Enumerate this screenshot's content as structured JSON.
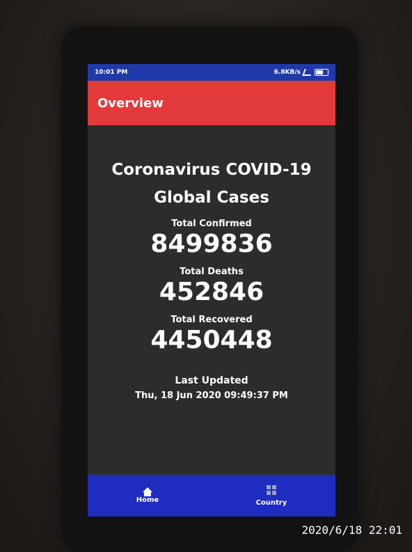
{
  "status_bar": {
    "time": "10:01 PM",
    "speed": "6.8KB/s"
  },
  "app_bar": {
    "title": "Overview"
  },
  "main": {
    "heading_line1": "Coronavirus COVID-19",
    "heading_line2": "Global Cases",
    "confirmed_label": "Total Confirmed",
    "confirmed_value": "8499836",
    "deaths_label": "Total Deaths",
    "deaths_value": "452846",
    "recovered_label": "Total Recovered",
    "recovered_value": "4450448",
    "last_updated_label": "Last Updated",
    "last_updated_value": "Thu, 18 Jun 2020 09:49:37 PM"
  },
  "bottom_nav": {
    "items": [
      {
        "label": "Home",
        "icon": "home-icon"
      },
      {
        "label": "Country",
        "icon": "grid-icon"
      }
    ]
  },
  "photo_timestamp": "2020/6/18  22:01",
  "colors": {
    "status_bar": "#1f3aa8",
    "app_bar": "#e23a3a",
    "bottom_nav": "#1f2cc0",
    "screen_bg": "#2c2c2c"
  }
}
